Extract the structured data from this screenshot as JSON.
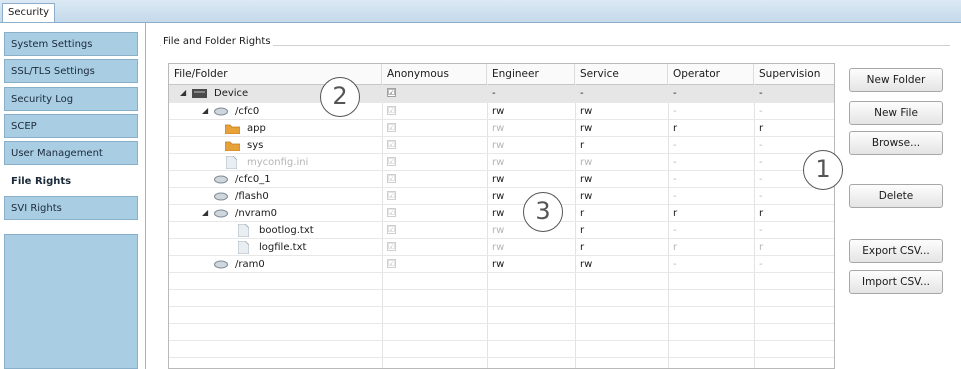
{
  "tab": {
    "label": "Security"
  },
  "sidebar": {
    "items": [
      {
        "label": "System Settings",
        "active": false
      },
      {
        "label": "SSL/TLS Settings",
        "active": false
      },
      {
        "label": "Security Log",
        "active": false
      },
      {
        "label": "SCEP",
        "active": false
      },
      {
        "label": "User Management",
        "active": false
      },
      {
        "label": "File Rights",
        "active": true
      },
      {
        "label": "SVI Rights",
        "active": false
      }
    ]
  },
  "group": {
    "title": "File and Folder Rights"
  },
  "table": {
    "columns": [
      "File/Folder",
      "Anonymous",
      "Engineer",
      "Service",
      "Operator",
      "Supervision"
    ],
    "rows": [
      {
        "name": "Device",
        "icon": "device-icon",
        "anonymous": "☑",
        "engineer": "-",
        "service": "-",
        "operator": "-",
        "supervision": "-"
      },
      {
        "name": "/cfc0",
        "icon": "drive-icon",
        "anonymous": "☑",
        "engineer": "rw",
        "service": "rw",
        "operator": "-",
        "supervision": "-"
      },
      {
        "name": "app",
        "icon": "folder-icon",
        "anonymous": "☑",
        "engineer": "rw",
        "service": "rw",
        "operator": "r",
        "supervision": "r"
      },
      {
        "name": "sys",
        "icon": "folder-icon",
        "anonymous": "☑",
        "engineer": "rw",
        "service": "r",
        "operator": "-",
        "supervision": "-"
      },
      {
        "name": "myconfig.ini",
        "icon": "file-icon",
        "anonymous": "☑",
        "engineer": "rw",
        "service": "rw",
        "operator": "-",
        "supervision": "-"
      },
      {
        "name": "/cfc0_1",
        "icon": "drive-icon",
        "anonymous": "☑",
        "engineer": "rw",
        "service": "rw",
        "operator": "-",
        "supervision": "-"
      },
      {
        "name": "/flash0",
        "icon": "drive-icon",
        "anonymous": "☑",
        "engineer": "rw",
        "service": "rw",
        "operator": "-",
        "supervision": "-"
      },
      {
        "name": "/nvram0",
        "icon": "drive-icon",
        "anonymous": "☑",
        "engineer": "rw",
        "service": "r",
        "operator": "r",
        "supervision": "r"
      },
      {
        "name": "bootlog.txt",
        "icon": "file-icon",
        "anonymous": "☑",
        "engineer": "rw",
        "service": "r",
        "operator": "-",
        "supervision": "-"
      },
      {
        "name": "logfile.txt",
        "icon": "file-icon",
        "anonymous": "☑",
        "engineer": "rw",
        "service": "r",
        "operator": "r",
        "supervision": "r"
      },
      {
        "name": "/ram0",
        "icon": "drive-icon",
        "anonymous": "☑",
        "engineer": "rw",
        "service": "rw",
        "operator": "-",
        "supervision": "-"
      }
    ]
  },
  "buttons": {
    "new_folder": "New Folder",
    "new_file": "New File",
    "browse": "Browse...",
    "delete": "Delete",
    "export_csv": "Export CSV...",
    "import_csv": "Import CSV..."
  },
  "callouts": {
    "one": "1",
    "two": "2",
    "three": "3"
  },
  "colors": {
    "sidebar_bg": "#a9cde3",
    "tab_strip": "#c4d9ea",
    "folder": "#e8a23a"
  }
}
